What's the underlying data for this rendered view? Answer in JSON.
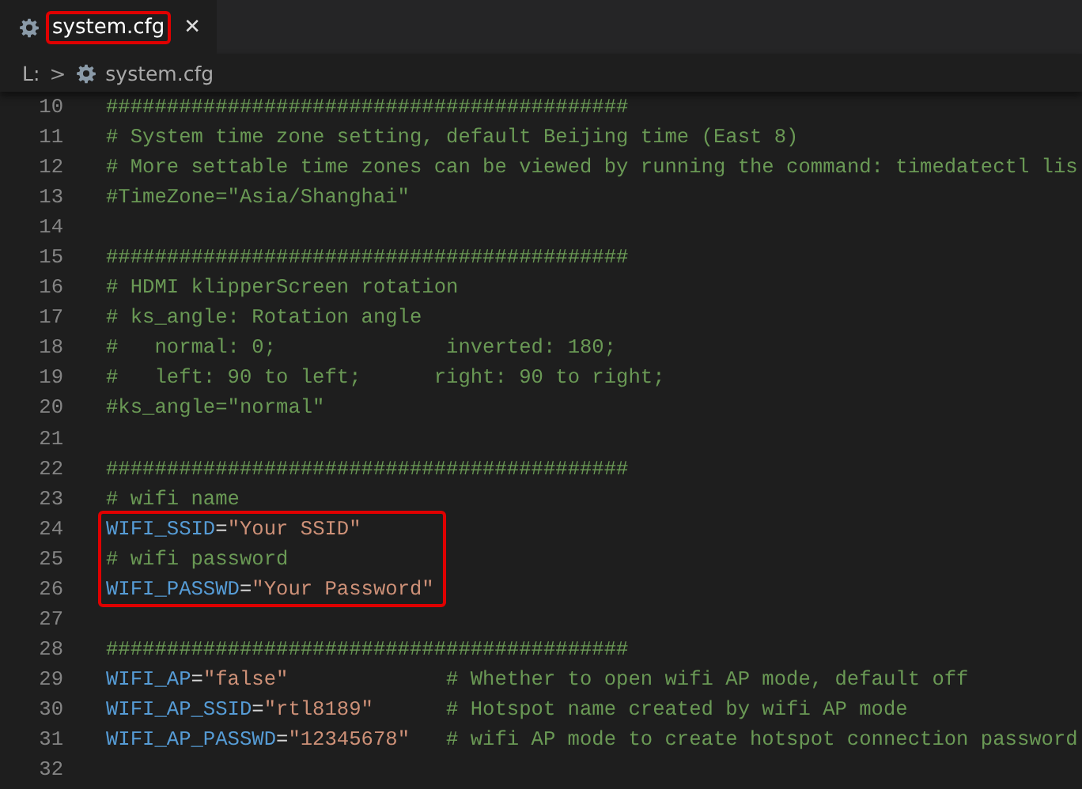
{
  "tabs": [
    {
      "label": "system.cfg",
      "selected": true,
      "highlighted": true,
      "close": "✕"
    }
  ],
  "breadcrumb": {
    "root": "L:",
    "separator": ">",
    "file": "system.cfg"
  },
  "lines": [
    {
      "kind": "line",
      "number": "10",
      "tokens": [
        {
          "kind": "comment",
          "text": "###########################################"
        }
      ]
    },
    {
      "kind": "line",
      "number": "11",
      "tokens": [
        {
          "kind": "comment",
          "text": "# System time zone setting, default Beijing time (East 8)"
        }
      ]
    },
    {
      "kind": "line",
      "number": "12",
      "tokens": [
        {
          "kind": "comment",
          "text": "# More settable time zones can be viewed by running the command: timedatectl lis"
        }
      ]
    },
    {
      "kind": "line",
      "number": "13",
      "tokens": [
        {
          "kind": "comment",
          "text": "#TimeZone=\"Asia/Shanghai\""
        }
      ]
    },
    {
      "kind": "line",
      "number": "14"
    },
    {
      "kind": "line",
      "number": "15",
      "tokens": [
        {
          "kind": "comment",
          "text": "###########################################"
        }
      ]
    },
    {
      "kind": "line",
      "number": "16",
      "tokens": [
        {
          "kind": "comment",
          "text": "# HDMI klipperScreen rotation"
        }
      ]
    },
    {
      "kind": "line",
      "number": "17",
      "tokens": [
        {
          "kind": "comment",
          "text": "# ks_angle: Rotation angle"
        }
      ]
    },
    {
      "kind": "line",
      "number": "18",
      "tokens": [
        {
          "kind": "comment",
          "text": "#   normal: 0;              inverted: 180;"
        }
      ]
    },
    {
      "kind": "line",
      "number": "19",
      "tokens": [
        {
          "kind": "comment",
          "text": "#   left: 90 to left;      right: 90 to right;"
        }
      ]
    },
    {
      "kind": "line",
      "number": "20",
      "tokens": [
        {
          "kind": "comment",
          "text": "#ks_angle=\"normal\""
        }
      ]
    },
    {
      "kind": "line",
      "number": "21"
    },
    {
      "kind": "line",
      "number": "22",
      "tokens": [
        {
          "kind": "comment",
          "text": "###########################################"
        }
      ]
    },
    {
      "kind": "line",
      "number": "23",
      "tokens": [
        {
          "kind": "comment",
          "text": "# wifi name"
        }
      ]
    },
    {
      "kind": "highlight_box",
      "lines": [
        {
          "number": "24",
          "tokens": [
            {
              "kind": "key",
              "text": "WIFI_SSID"
            },
            {
              "kind": "plain",
              "text": "="
            },
            {
              "kind": "string",
              "text": "\"Your SSID\""
            }
          ]
        },
        {
          "number": "25",
          "tokens": [
            {
              "kind": "comment",
              "text": "# wifi password"
            }
          ]
        },
        {
          "number": "26",
          "tokens": [
            {
              "kind": "key",
              "text": "WIFI_PASSWD"
            },
            {
              "kind": "plain",
              "text": "="
            },
            {
              "kind": "string",
              "text": "\"Your Password\""
            }
          ]
        }
      ]
    },
    {
      "kind": "line",
      "number": "27"
    },
    {
      "kind": "line",
      "number": "28",
      "tokens": [
        {
          "kind": "comment",
          "text": "###########################################"
        }
      ]
    },
    {
      "kind": "line",
      "number": "29",
      "tokens": [
        {
          "kind": "key",
          "text": "WIFI_AP"
        },
        {
          "kind": "plain",
          "text": "="
        },
        {
          "kind": "string",
          "text": "\"false\""
        },
        {
          "kind": "trailing_comment",
          "text": "# Whether to open wifi AP mode, default off"
        }
      ]
    },
    {
      "kind": "line",
      "number": "30",
      "tokens": [
        {
          "kind": "key",
          "text": "WIFI_AP_SSID"
        },
        {
          "kind": "plain",
          "text": "="
        },
        {
          "kind": "string",
          "text": "\"rtl8189\""
        },
        {
          "kind": "trailing_comment",
          "text": "# Hotspot name created by wifi AP mode"
        }
      ]
    },
    {
      "kind": "line",
      "number": "31",
      "tokens": [
        {
          "kind": "key",
          "text": "WIFI_AP_PASSWD"
        },
        {
          "kind": "plain",
          "text": "="
        },
        {
          "kind": "string",
          "text": "\"12345678\""
        },
        {
          "kind": "trailing_comment",
          "text": "# wifi AP mode to create hotspot connection password"
        }
      ]
    },
    {
      "kind": "line",
      "number": "32"
    }
  ]
}
